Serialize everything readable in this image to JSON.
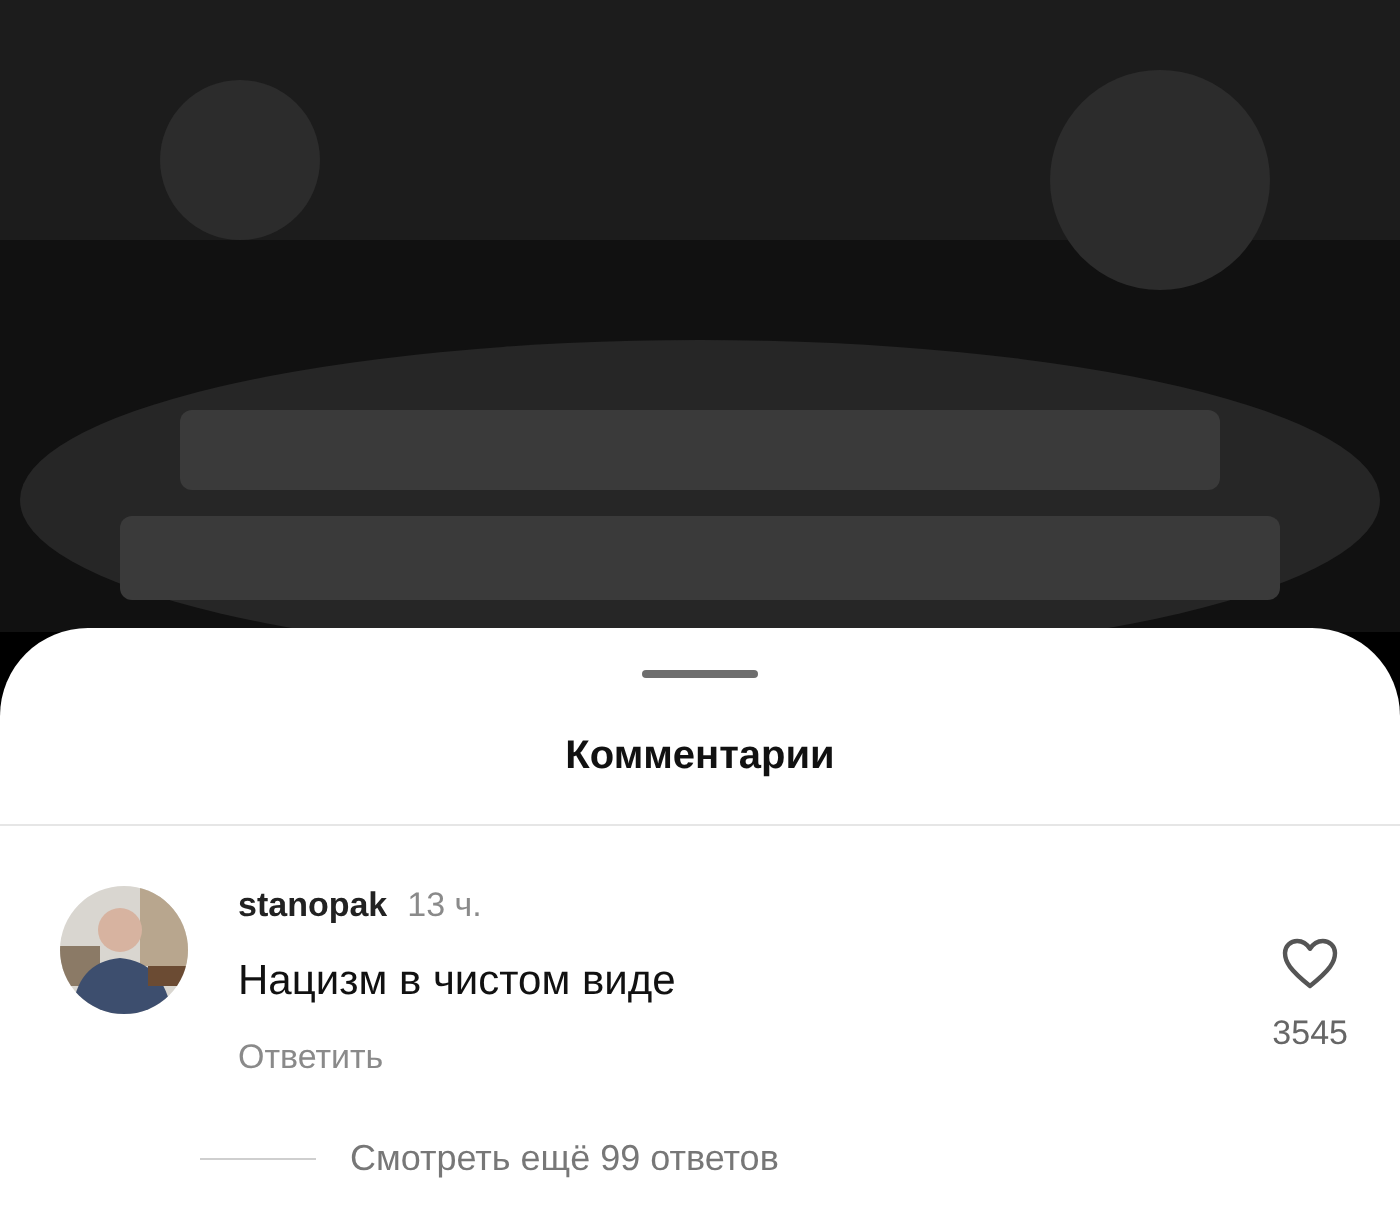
{
  "sheet": {
    "title": "Комментарии"
  },
  "comments": [
    {
      "username": "stanopak",
      "time": "13 ч.",
      "text": "Нацизм в чистом виде",
      "reply": "Ответить",
      "liked": false,
      "likes": "3545",
      "more_replies": "Смотреть ещё 99 ответов"
    }
  ]
}
